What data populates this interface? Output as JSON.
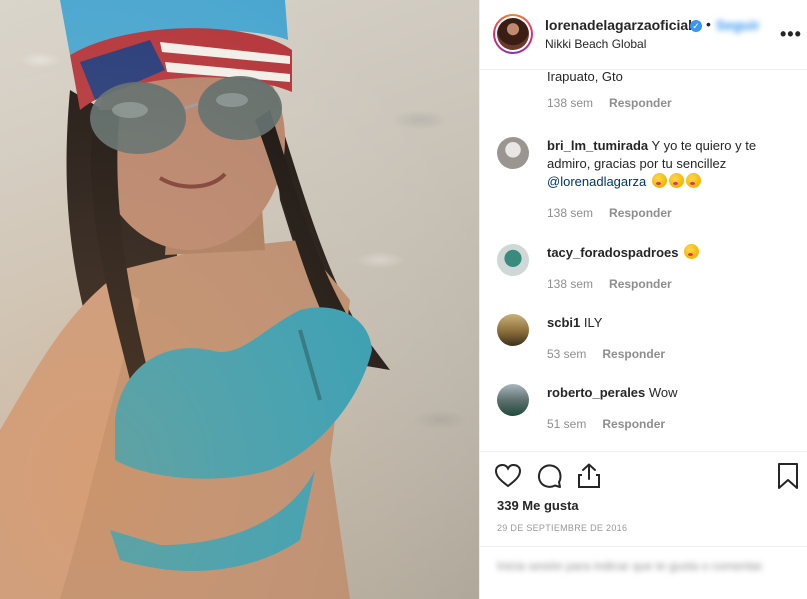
{
  "post": {
    "username": "lorenadelagarza oficial",
    "username_display": "lorenadelagarzaoficial",
    "verified": true,
    "follow_label": "Seguir",
    "location": "Nikki Beach Global",
    "more_icon": "more-options-icon"
  },
  "comments": [
    {
      "user": "",
      "text": "Irapuato, Gto",
      "age": "138 sem",
      "reply": "Responder"
    },
    {
      "user": "bri_lm_tumirada",
      "text": "Y yo te quiero y te admiro, gracias por tu sencillez",
      "mention": "@lorenadlagarza",
      "age": "138 sem",
      "reply": "Responder"
    },
    {
      "user": "tacy_foradospadroes",
      "text": "",
      "age": "138 sem",
      "reply": "Responder"
    },
    {
      "user": "scbi1",
      "text": "ILY",
      "age": "53 sem",
      "reply": "Responder"
    },
    {
      "user": "roberto_perales",
      "text": "Wow",
      "age": "51 sem",
      "reply": "Responder"
    }
  ],
  "actions": {
    "icons": [
      "heart-icon",
      "comment-icon",
      "share-icon",
      "bookmark-icon"
    ],
    "likes": "339 Me gusta",
    "date": "29 DE SEPTIEMBRE DE 2016"
  },
  "login_prompt": "Inicia sesión para indicar que te gusta o comentar.",
  "colors": {
    "link": "#003569",
    "accent": "#3897f0",
    "muted": "#8e8e8e",
    "text": "#262626"
  }
}
